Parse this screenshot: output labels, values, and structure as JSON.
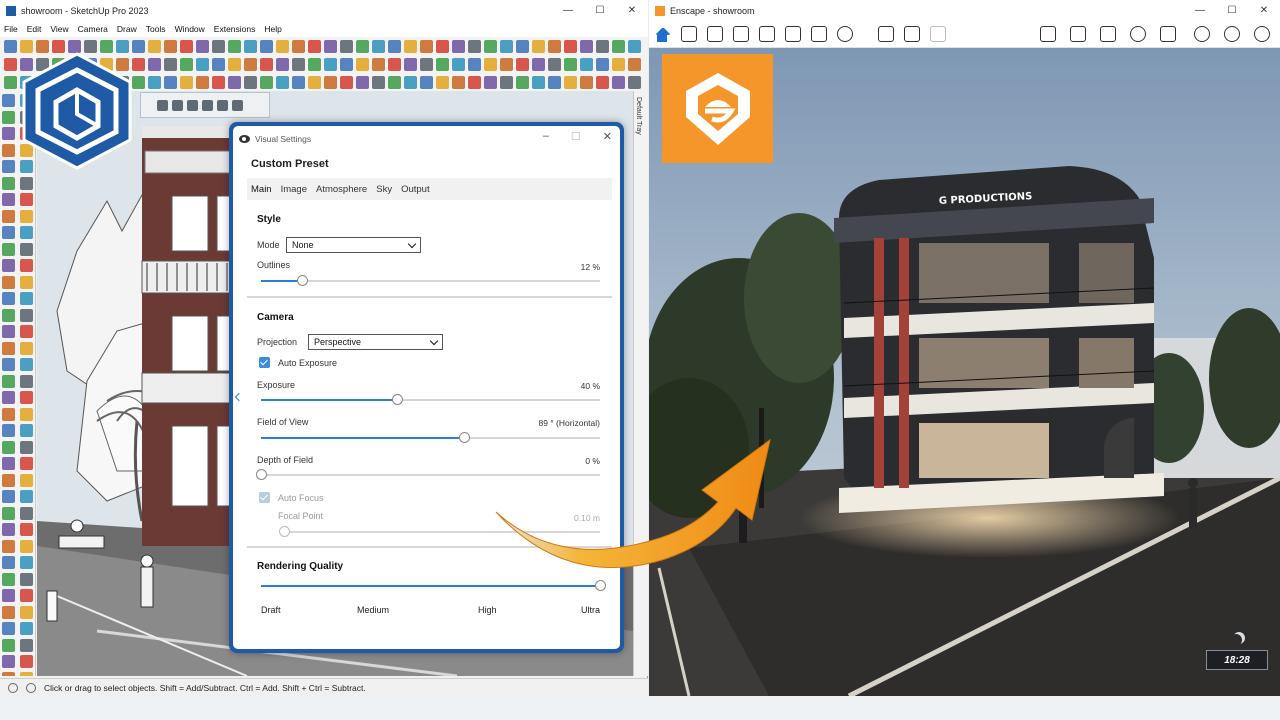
{
  "sketchup": {
    "window_title": "showroom - SketchUp Pro 2023",
    "menu": [
      "File",
      "Edit",
      "View",
      "Camera",
      "Draw",
      "Tools",
      "Window",
      "Extensions",
      "Help"
    ],
    "tray_label": "Default Tray",
    "status_text": "Click or drag to select objects. Shift = Add/Subtract. Ctrl = Add. Shift + Ctrl = Subtract."
  },
  "visual_settings": {
    "window_title": "Visual Settings",
    "preset_name": "Custom Preset",
    "tabs": [
      "Main",
      "Image",
      "Atmosphere",
      "Sky",
      "Output"
    ],
    "active_tab": "Main",
    "style": {
      "heading": "Style",
      "mode_label": "Mode",
      "mode_value": "None",
      "outlines_label": "Outlines",
      "outlines_value": "12 %",
      "outlines_level": 0.12
    },
    "camera": {
      "heading": "Camera",
      "projection_label": "Projection",
      "projection_value": "Perspective",
      "auto_exposure_label": "Auto Exposure",
      "auto_exposure_checked": true,
      "exposure_label": "Exposure",
      "exposure_value": "40 %",
      "exposure_level": 0.4,
      "fov_label": "Field of View",
      "fov_value": "89 ° (Horizontal)",
      "fov_level": 0.6,
      "dof_label": "Depth of Field",
      "dof_value": "0 %",
      "dof_level": 0.0,
      "auto_focus_label": "Auto Focus",
      "auto_focus_checked": true,
      "focal_point_label": "Focal Point",
      "focal_point_value": "0.10 m",
      "focal_point_level": 0.0
    },
    "quality": {
      "heading": "Rendering Quality",
      "levels": [
        "Draft",
        "Medium",
        "High",
        "Ultra"
      ],
      "selected": "Ultra",
      "level": 1.0
    }
  },
  "enscape": {
    "window_title": "Enscape - showroom",
    "building_sign": "G PRODUCTIONS",
    "time": "18:28"
  },
  "colors": {
    "sketchup_blue": "#1f5aa6",
    "enscape_orange": "#f5962b",
    "slider_blue": "#2a7fd4"
  }
}
